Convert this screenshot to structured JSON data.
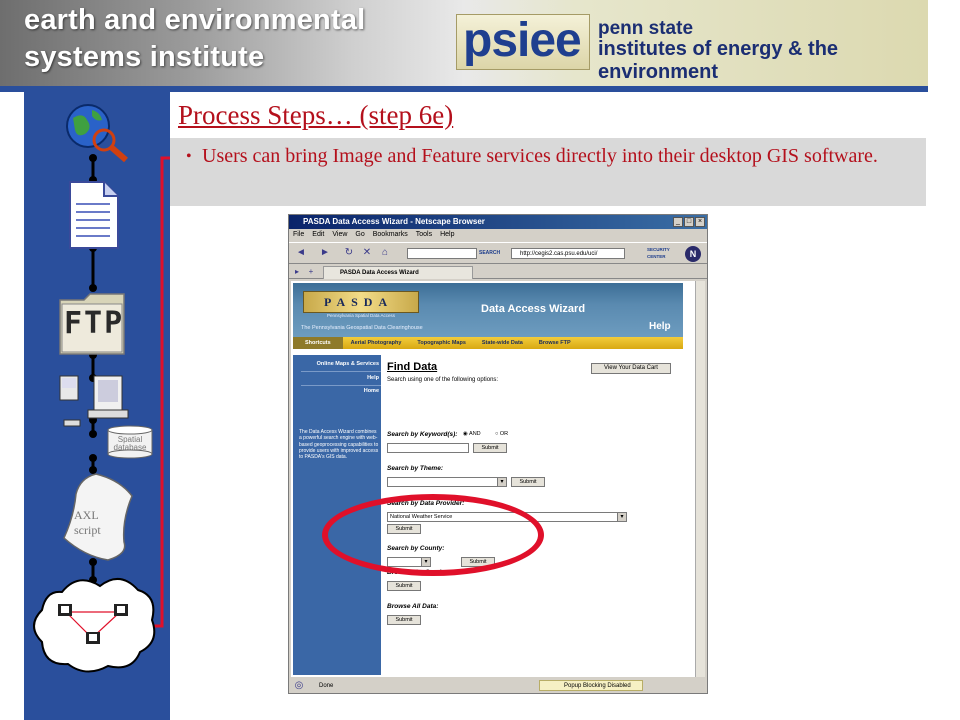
{
  "banner": {
    "institute_line1": "earth and environmental",
    "institute_line2": "systems institute",
    "psiee_logo_word": "psiee",
    "psu_line1": "penn state",
    "psu_line2": "institutes of energy & the environment"
  },
  "slide": {
    "title": "Process Steps… (step 6e)",
    "bullet": "Users can bring Image and Feature services directly into their desktop GIS software."
  },
  "diagram": {
    "ftp_label": "FTP",
    "spatial_db_label": "Spatial database",
    "axl_label_1": "AXL",
    "axl_label_2": "script"
  },
  "browser": {
    "window_title": "PASDA Data Access Wizard - Netscape Browser",
    "menu": [
      "File",
      "Edit",
      "View",
      "Go",
      "Bookmarks",
      "Tools",
      "Help"
    ],
    "search_button": "SEARCH",
    "url": "http://cegis2.cas.psu.edu/uci/",
    "security_center": "SECURITY CENTER",
    "tab_title": "PASDA Data Access Wizard",
    "status": "Done",
    "popup_status": "Popup Blocking Disabled"
  },
  "pasda": {
    "logo_text": "PASDA",
    "logo_subtitle": "Pennsylvania Spatial Data Access",
    "tagline": "The Pennsylvania Geospatial Data Clearinghouse",
    "wizard_title": "Data Access Wizard",
    "help_header": "Help",
    "nav": [
      "Shortcuts",
      "Aerial Photography",
      "Topographic Maps",
      "State-wide Data",
      "Browse FTP"
    ],
    "side_items": [
      "Online Maps & Services",
      "Help",
      "Home"
    ],
    "side_description": "The Data Access Wizard combines a powerful search engine with web-based geoprocessing capabilities to provide users with improved access to PASDA's GIS data.",
    "find_title": "Find Data",
    "find_subtitle": "Search using one of the following options:",
    "view_cart": "View Your Data Cart",
    "keyword_label": "Search by Keyword(s):",
    "and_label": "AND",
    "or_label": "OR",
    "theme_label": "Search by Theme:",
    "provider_label": "Search by Data Provider:",
    "provider_selected": "National Weather Service",
    "county_label": "Search by County:",
    "browse_map_label": "Browse MapServices:",
    "browse_all_label": "Browse All Data:",
    "submit": "Submit"
  },
  "colors": {
    "accent_red": "#b4101c",
    "strip_blue": "#2a4f9c",
    "highlight_red": "#e0102a"
  }
}
